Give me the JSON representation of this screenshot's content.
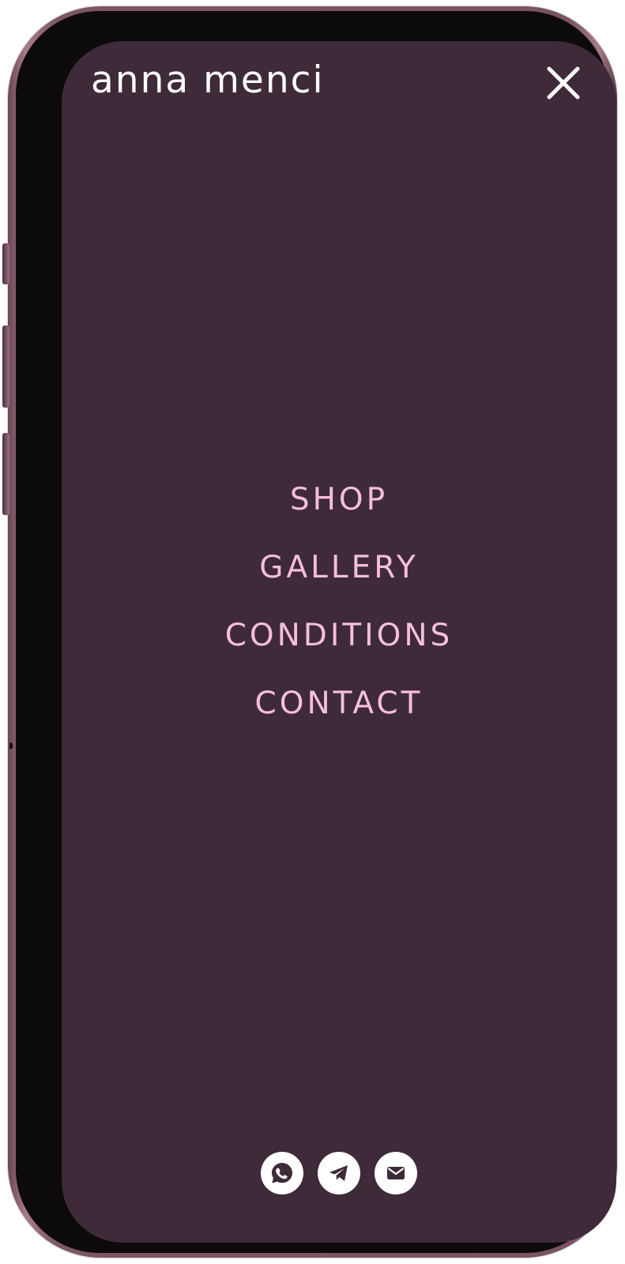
{
  "brand": {
    "logo_text": "anna menci"
  },
  "header": {
    "close_icon": "close-icon"
  },
  "menu": {
    "items": [
      {
        "label": "SHOP"
      },
      {
        "label": "GALLERY"
      },
      {
        "label": "CONDITIONS"
      },
      {
        "label": "CONTACT"
      }
    ]
  },
  "socials": [
    {
      "icon": "whatsapp-icon"
    },
    {
      "icon": "telegram-icon"
    },
    {
      "icon": "mail-icon"
    }
  ],
  "colors": {
    "background": "#3e2a38",
    "menu_text": "#f6bfd9",
    "logo_text": "#ffffff",
    "icon_bg": "#ffffff",
    "icon_fg": "#3e2a38"
  }
}
